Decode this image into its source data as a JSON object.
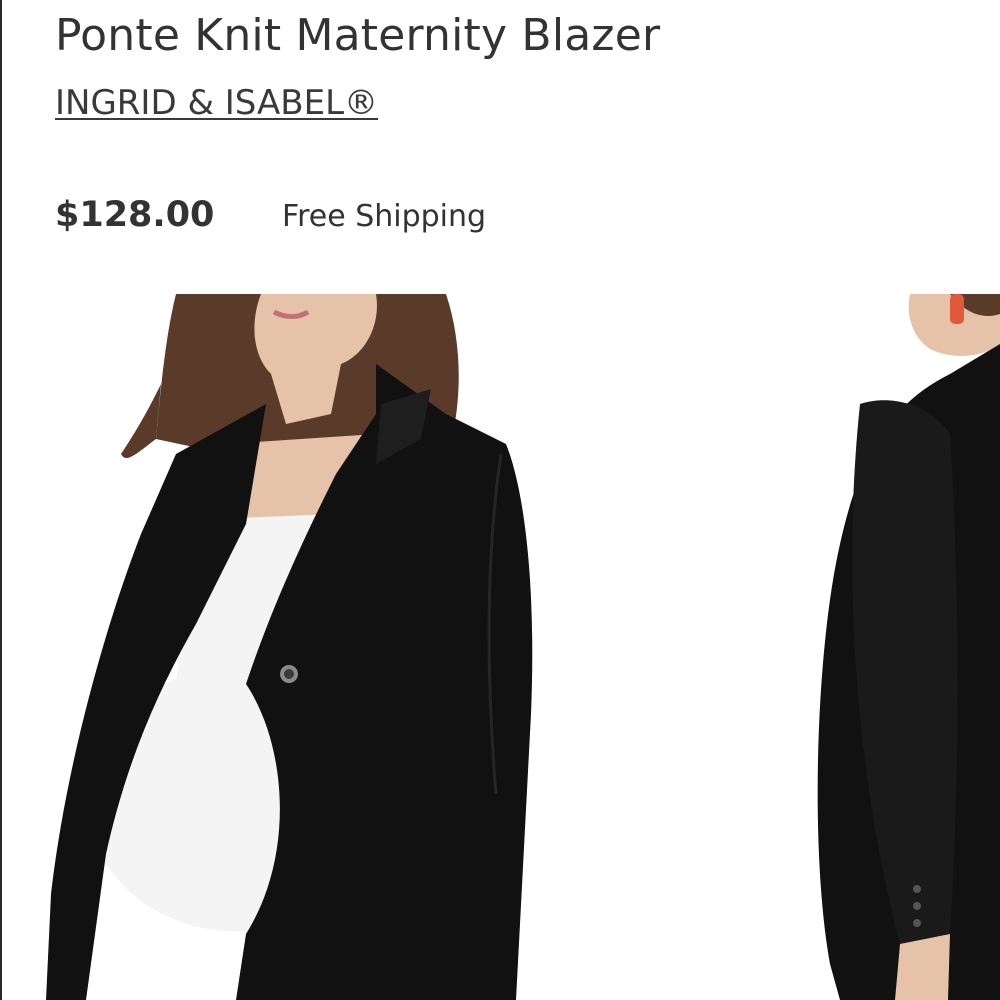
{
  "product": {
    "title": "Ponte Knit Maternity Blazer",
    "brand": "INGRID & ISABEL®",
    "price": "$128.00",
    "shipping": "Free Shipping"
  },
  "gallery": {
    "images": [
      {
        "name": "front-view",
        "subject": "model wearing black blazer over white top, front view"
      },
      {
        "name": "back-view",
        "subject": "model wearing black blazer, back view"
      }
    ]
  },
  "colors": {
    "text": "#333333",
    "blazer": "#111111",
    "top": "#f4f4f4",
    "hair": "#5a3b2a",
    "skin": "#e6c2a8",
    "accent": "#e05a3a"
  }
}
